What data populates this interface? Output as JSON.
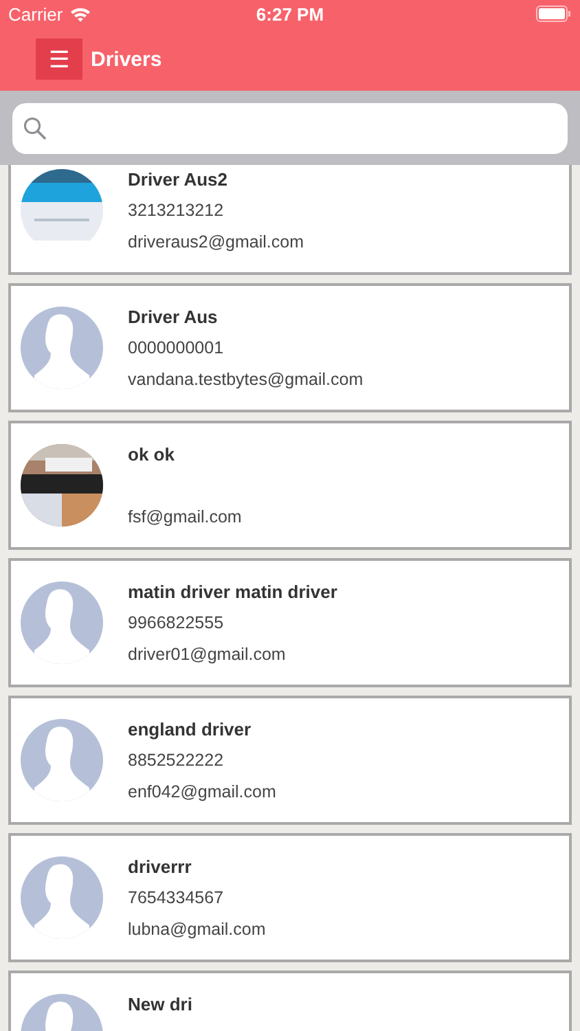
{
  "status_bar": {
    "carrier": "Carrier",
    "time": "6:27 PM"
  },
  "nav": {
    "menu_icon": "☰",
    "title": "Drivers"
  },
  "drivers": [
    {
      "name": "Driver Aus2",
      "phone": "3213213212",
      "email": "driveraus2@gmail.com",
      "kind": "picture"
    },
    {
      "name": "Driver Aus",
      "phone": "0000000001",
      "email": "vandana.testbytes@gmail.com",
      "kind": "placeholder"
    },
    {
      "name": "ok ok",
      "email": "fsf@gmail.com",
      "kind": "picture"
    },
    {
      "name": "matin driver matin driver",
      "phone": "9966822555",
      "email": "driver01@gmail.com",
      "kind": "placeholder"
    },
    {
      "name": "england driver",
      "phone": "8852522222",
      "email": "enf042@gmail.com",
      "kind": "placeholder"
    },
    {
      "name": "driverrr",
      "phone": "7654334567",
      "email": "lubna@gmail.com",
      "kind": "placeholder"
    },
    {
      "name": "New dri",
      "kind": "placeholder"
    }
  ]
}
